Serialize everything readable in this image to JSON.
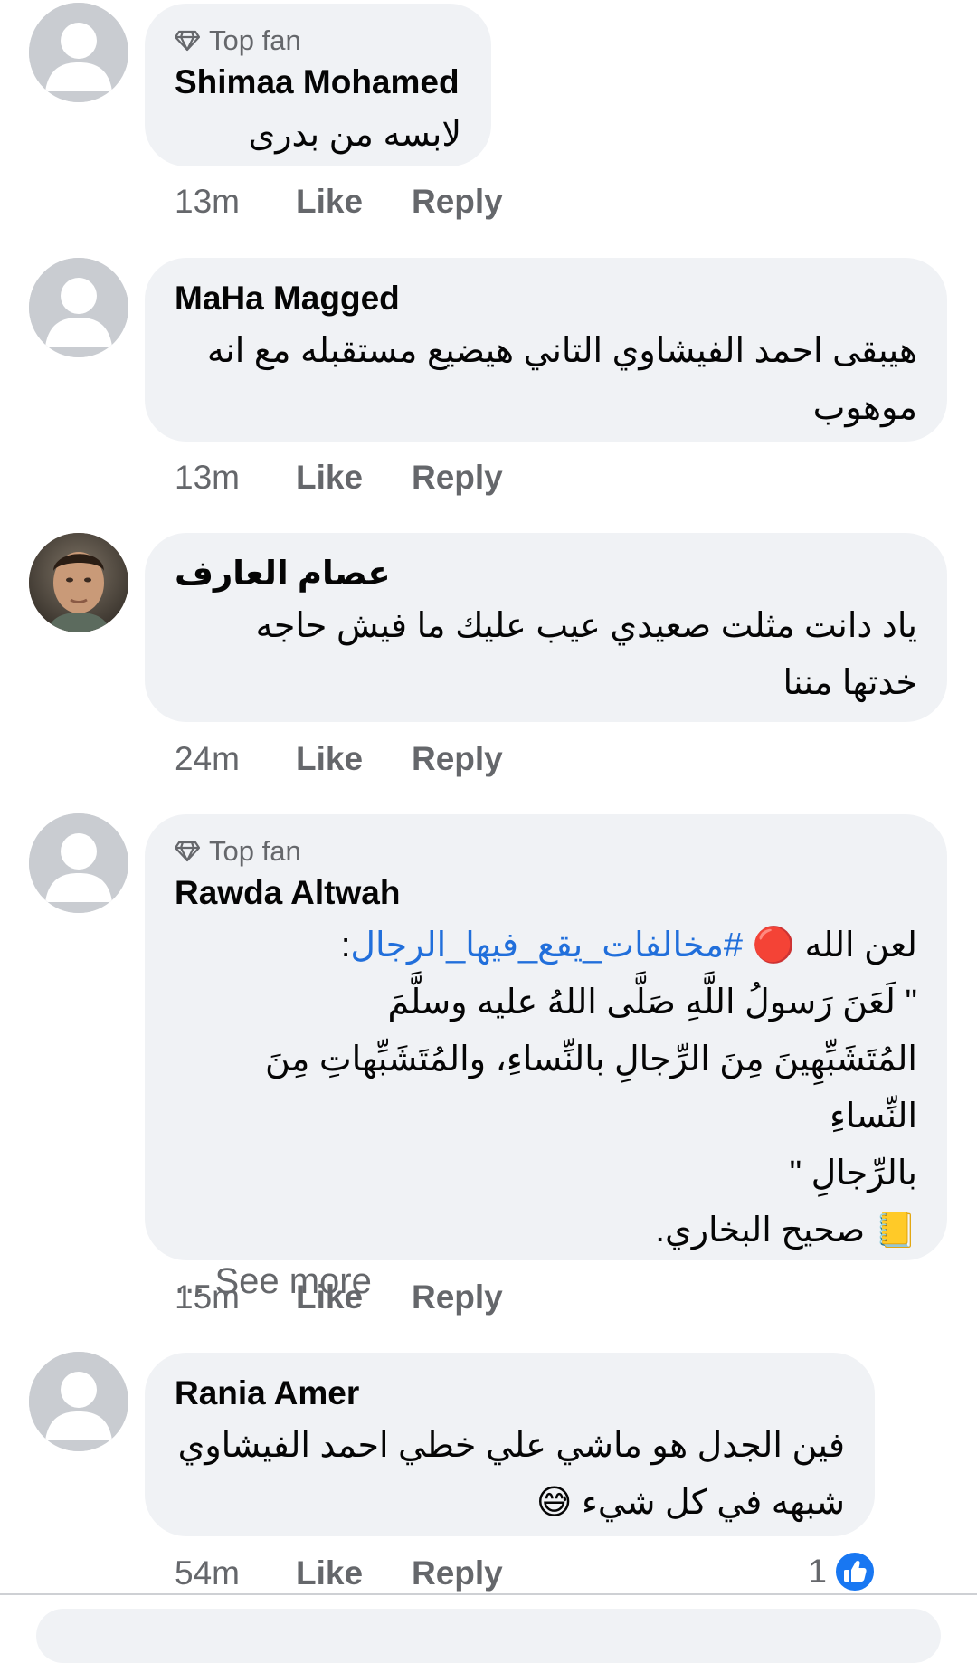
{
  "comments": [
    {
      "top_fan_label": "Top fan",
      "author": "Shimaa Mohamed",
      "text_lines": [
        "لابسه من بدرى"
      ],
      "time": "13m",
      "like_label": "Like",
      "reply_label": "Reply",
      "avatar": "default-avatar-icon"
    },
    {
      "author": "MaHa Magged",
      "text_lines": [
        "هيبقى احمد الفيشاوي التاني هيضيع مستقبله مع انه",
        "موهوب"
      ],
      "time": "13m",
      "like_label": "Like",
      "reply_label": "Reply",
      "avatar": "default-avatar-icon"
    },
    {
      "author": "عصام العارف",
      "text_lines": [
        "ياد دانت مثلت صعيدي عيب عليك ما فيش حاجه",
        "خدتها مننا"
      ],
      "time": "24m",
      "like_label": "Like",
      "reply_label": "Reply",
      "avatar": "profile-photo"
    },
    {
      "top_fan_label": "Top fan",
      "author": "Rawda Altwah",
      "line1_prefix": "لعن الله",
      "line1_emoji": "🔴",
      "hashtag": "#مخالفات_يقع_فيها_الرجال",
      "hashtag_suffix": ":",
      "text_lines": [
        "\" لَعَنَ رَسولُ اللَّهِ صَلَّى اللهُ عليه وسلَّمَ",
        "المُتَشَبِّهِينَ مِنَ الرِّجالِ بالنِّساءِ، والمُتَشَبِّهاتِ مِنَ النِّساءِ",
        "بالرِّجالِ \""
      ],
      "source_emoji": "📒",
      "source": "صحيح البخاري.",
      "see_more": "... See more",
      "time": "15m",
      "like_label": "Like",
      "reply_label": "Reply",
      "avatar": "default-avatar-icon"
    },
    {
      "author": "Rania Amer",
      "text_lines": [
        "فين الجدل هو ماشي علي خطي احمد الفيشاوي"
      ],
      "text_line2": "شبهه في كل شيء",
      "text_line2_emoji": "😅",
      "time": "54m",
      "like_label": "Like",
      "reply_label": "Reply",
      "reaction_count": "1",
      "reaction_icon": "like-reaction-icon",
      "avatar": "default-avatar-icon"
    }
  ],
  "colors": {
    "bubble": "#f0f2f5",
    "secondary_text": "#65676b",
    "hashtag": "#216fdb",
    "like_blue": "#1877f2"
  }
}
